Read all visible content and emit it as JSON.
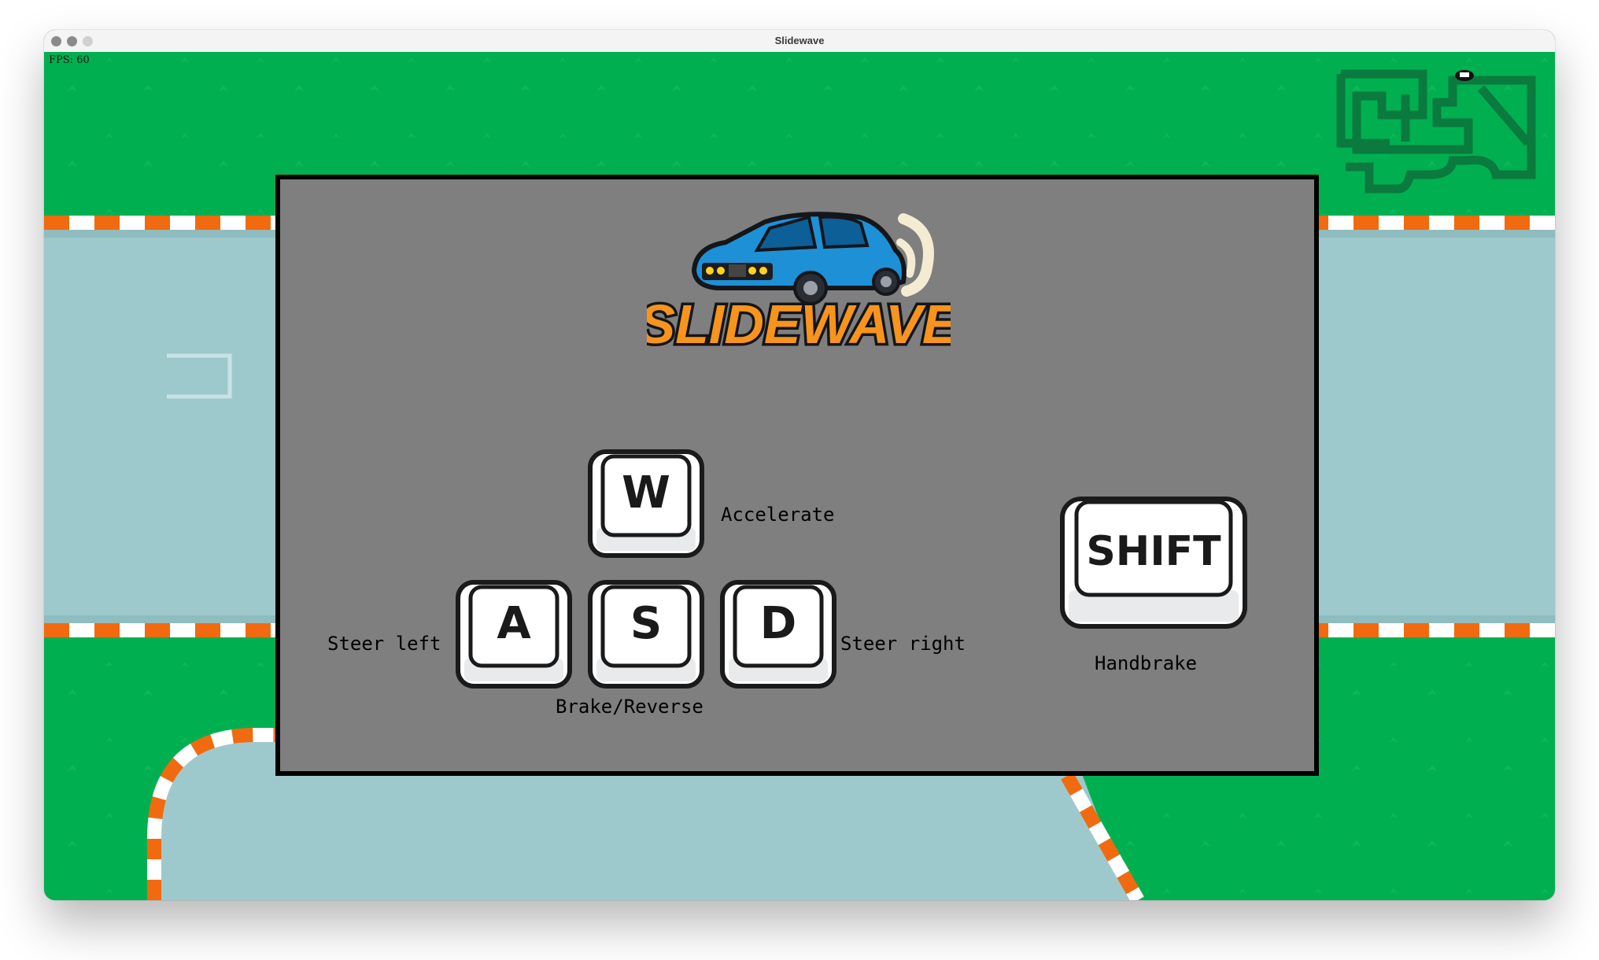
{
  "window": {
    "title": "Slidewave",
    "traffic_lights": [
      "close",
      "minimize",
      "zoom"
    ]
  },
  "hud": {
    "fps": "FPS: 60"
  },
  "logo": {
    "text": "SLIDEWAVE",
    "car_color": "#1e90d6",
    "text_color": "#f7941d"
  },
  "controls": {
    "w": {
      "key": "W",
      "label": "Accelerate"
    },
    "a": {
      "key": "A",
      "label": "Steer left"
    },
    "s": {
      "key": "S",
      "label": "Brake/Reverse"
    },
    "d": {
      "key": "D",
      "label": "Steer right"
    },
    "shift": {
      "key": "SHIFT",
      "label": "Handbrake"
    }
  },
  "colors": {
    "grass": "#00b050",
    "track": "#9ec9cc",
    "curb_orange": "#f26a10",
    "curb_white": "#ffffff",
    "overlay": "#7f7f7f",
    "minimap": "#0a7a3e"
  }
}
